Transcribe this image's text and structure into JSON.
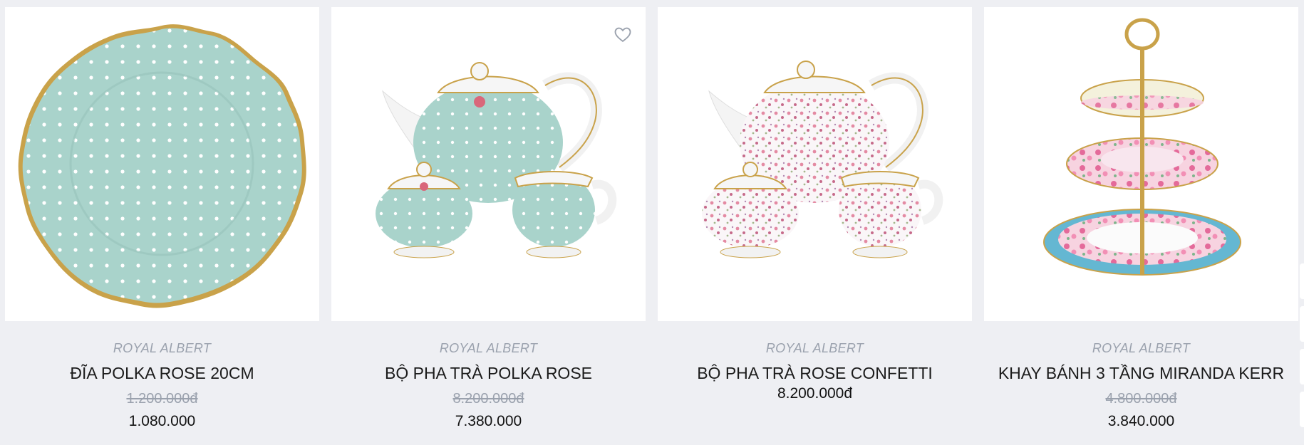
{
  "products": [
    {
      "brand": "ROYAL ALBERT",
      "name": "ĐĨA POLKA ROSE 20CM",
      "old_price": "1.200.000đ",
      "price": "1.080.000"
    },
    {
      "brand": "ROYAL ALBERT",
      "name": "BỘ PHA TRÀ POLKA ROSE",
      "old_price": "8.200.000đ",
      "price": "7.380.000"
    },
    {
      "brand": "ROYAL ALBERT",
      "name": "BỘ PHA TRÀ ROSE CONFETTI",
      "price": "8.200.000đ"
    },
    {
      "brand": "ROYAL ALBERT",
      "name": "KHAY BÁNH 3 TẦNG MIRANDA KERR",
      "old_price": "4.800.000đ",
      "price": "3.840.000"
    }
  ],
  "colors": {
    "background": "#eeeff3",
    "card": "#ffffff",
    "muted_text": "#9aa1ad",
    "polka_mint": "#a9d3cb",
    "gold_rim": "#c9a24a"
  }
}
